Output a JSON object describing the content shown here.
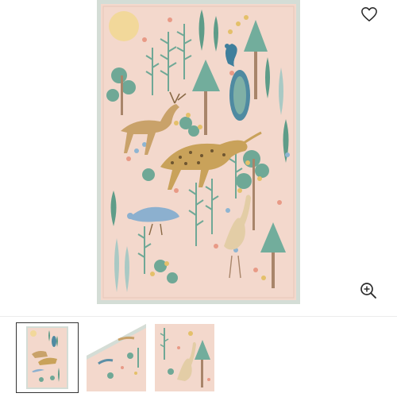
{
  "product_gallery": {
    "main_image_label": "",
    "wishlist_icon": "heart-outline-icon",
    "zoom_icon": "magnify-plus-icon",
    "selected_thumbnail": 1,
    "thumbnails": [
      {
        "view": "full-rug"
      },
      {
        "view": "corner-angle"
      },
      {
        "view": "detail-closeup"
      }
    ]
  },
  "colors": {
    "rug_field": "#f2d6c9",
    "rug_border": "#c9d8d2",
    "foliage": "#6fa896",
    "gold": "#c9a45a",
    "peacock": "#5c8fa6"
  }
}
